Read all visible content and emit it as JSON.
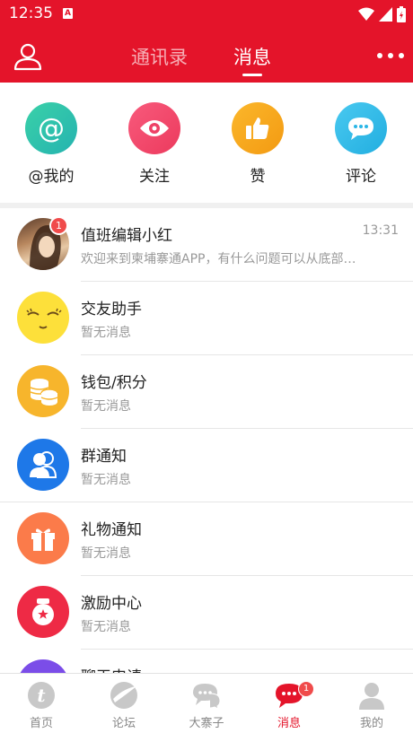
{
  "status_bar": {
    "time": "12:35",
    "notification_icon": "A"
  },
  "header": {
    "tabs": [
      {
        "label": "通讯录",
        "active": false
      },
      {
        "label": "消息",
        "active": true
      }
    ]
  },
  "quick_actions": [
    {
      "label": "@我的",
      "icon": "at-icon",
      "color": "#2ec4a6"
    },
    {
      "label": "关注",
      "icon": "eye-icon",
      "color": "#f0476a"
    },
    {
      "label": "赞",
      "icon": "thumbs-up-icon",
      "color": "#f6a71d"
    },
    {
      "label": "评论",
      "icon": "comment-icon",
      "color": "#33b8e8"
    }
  ],
  "messages": [
    {
      "title": "值班编辑小红",
      "subtitle": "欢迎来到柬埔寨通APP，有什么问题可以从底部…",
      "time": "13:31",
      "badge": "1",
      "icon": "user-photo"
    },
    {
      "title": "交友助手",
      "subtitle": "暂无消息",
      "time": "",
      "icon": "smile-face-icon",
      "color": "#fde03a"
    },
    {
      "title": "钱包/积分",
      "subtitle": "暂无消息",
      "time": "",
      "icon": "coins-icon",
      "color": "#f7b52c"
    },
    {
      "title": "群通知",
      "subtitle": "暂无消息",
      "time": "",
      "icon": "group-icon",
      "color": "#1e78e8"
    },
    {
      "title": "礼物通知",
      "subtitle": "暂无消息",
      "time": "",
      "icon": "gift-icon",
      "color": "#fb7b4a"
    },
    {
      "title": "激励中心",
      "subtitle": "暂无消息",
      "time": "",
      "icon": "medal-icon",
      "color": "#ee2a45"
    },
    {
      "title": "聊天申请",
      "subtitle": "",
      "time": "",
      "icon": "chat-request-icon",
      "color": "#7b4de8"
    }
  ],
  "bottom_nav": [
    {
      "label": "首页",
      "icon": "home-icon",
      "active": false
    },
    {
      "label": "论坛",
      "icon": "forum-icon",
      "active": false
    },
    {
      "label": "大寨子",
      "icon": "chat-bubbles-icon",
      "active": false
    },
    {
      "label": "消息",
      "icon": "message-icon",
      "active": true,
      "badge": "1"
    },
    {
      "label": "我的",
      "icon": "profile-icon",
      "active": false
    }
  ],
  "colors": {
    "brand_red": "#e4142a",
    "badge_red": "#f04b4b",
    "muted_text": "#999999"
  }
}
